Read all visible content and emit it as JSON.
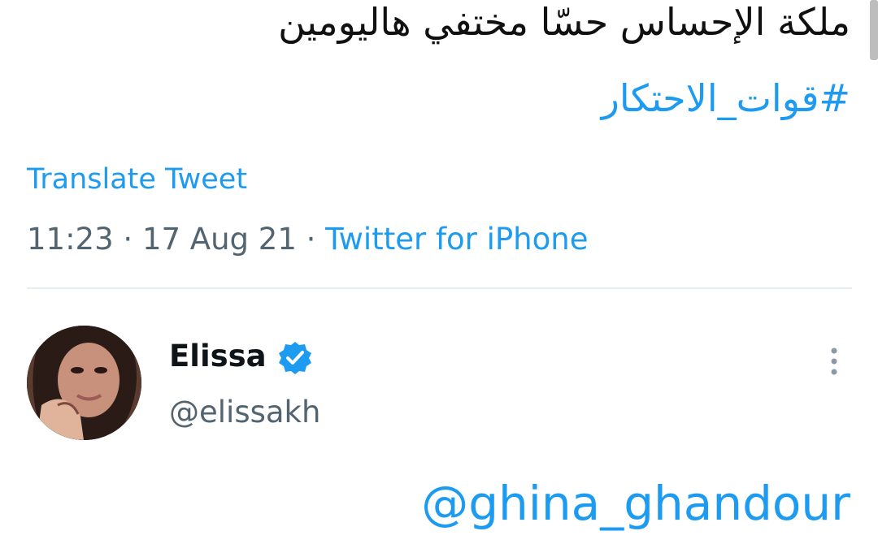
{
  "tweet": {
    "text_line": "ملكة الإحساس حسّا مختفي هاليومين",
    "hashtag": "#قوات_الاحتكار",
    "translate_label": "Translate Tweet",
    "time": "11:23",
    "date": "17 Aug 21",
    "separator": " · ",
    "source": "Twitter for iPhone"
  },
  "reply": {
    "author_name": "Elissa",
    "author_handle": "@elissakh",
    "verified_icon": "verified-badge-icon",
    "more_icon": "more-vertical-icon",
    "mention": "@ghina_ghandour"
  },
  "colors": {
    "accent": "#1d9bf0",
    "text": "#0f1419",
    "muted": "#536471",
    "divider": "#e6ecf0"
  }
}
